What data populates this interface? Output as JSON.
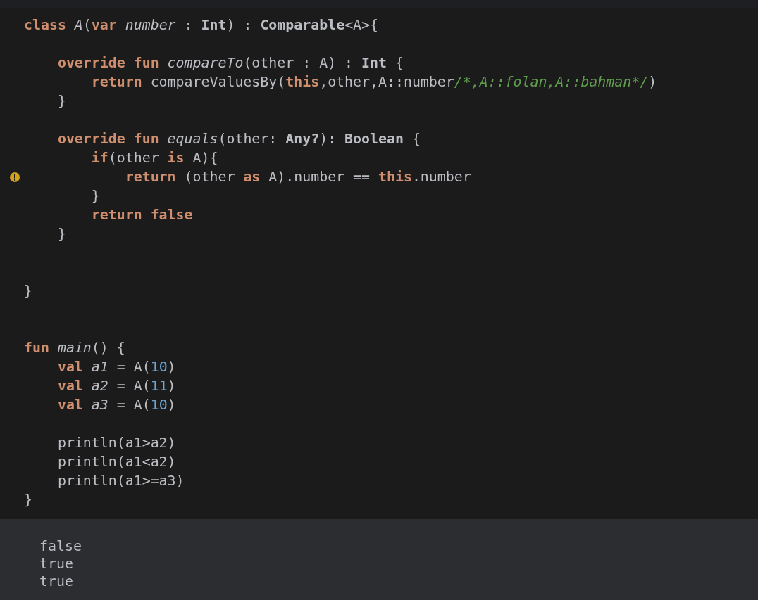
{
  "editor": {
    "lines": [
      {
        "kind": "code",
        "warning": false,
        "tokens": [
          {
            "t": "class ",
            "kind": "kw"
          },
          {
            "t": "A",
            "kind": "italic"
          },
          {
            "t": "(",
            "kind": "txt"
          },
          {
            "t": "var ",
            "kind": "kw"
          },
          {
            "t": "number",
            "kind": "italic"
          },
          {
            "t": " : ",
            "kind": "txt"
          },
          {
            "t": "Int",
            "kind": "type"
          },
          {
            "t": ") : ",
            "kind": "txt"
          },
          {
            "t": "Comparable",
            "kind": "type"
          },
          {
            "t": "<A>{",
            "kind": "txt"
          }
        ]
      },
      {
        "kind": "blank",
        "warning": false
      },
      {
        "kind": "code",
        "warning": false,
        "tokens": [
          {
            "t": "    override fun ",
            "kind": "kw"
          },
          {
            "t": "compareTo",
            "kind": "italic"
          },
          {
            "t": "(other : A) : ",
            "kind": "txt"
          },
          {
            "t": "Int",
            "kind": "type"
          },
          {
            "t": " {",
            "kind": "txt"
          }
        ]
      },
      {
        "kind": "code",
        "warning": false,
        "tokens": [
          {
            "t": "        return",
            "kind": "kw"
          },
          {
            "t": " compareValuesBy(",
            "kind": "txt"
          },
          {
            "t": "this",
            "kind": "kw"
          },
          {
            "t": ",other,A::number",
            "kind": "txt"
          },
          {
            "t": "/*,A::folan,A::bahman*/",
            "kind": "comment"
          },
          {
            "t": ")",
            "kind": "txt"
          }
        ]
      },
      {
        "kind": "code",
        "warning": false,
        "tokens": [
          {
            "t": "    }",
            "kind": "txt"
          }
        ]
      },
      {
        "kind": "blank",
        "warning": false
      },
      {
        "kind": "code",
        "warning": false,
        "tokens": [
          {
            "t": "    override fun ",
            "kind": "kw"
          },
          {
            "t": "equals",
            "kind": "italic"
          },
          {
            "t": "(other: ",
            "kind": "txt"
          },
          {
            "t": "Any?",
            "kind": "type"
          },
          {
            "t": "): ",
            "kind": "txt"
          },
          {
            "t": "Boolean",
            "kind": "type"
          },
          {
            "t": " {",
            "kind": "txt"
          }
        ]
      },
      {
        "kind": "code",
        "warning": false,
        "tokens": [
          {
            "t": "        if",
            "kind": "kw"
          },
          {
            "t": "(other ",
            "kind": "txt"
          },
          {
            "t": "is",
            "kind": "kw"
          },
          {
            "t": " A){",
            "kind": "txt"
          }
        ]
      },
      {
        "kind": "code",
        "warning": true,
        "tokens": [
          {
            "t": "            return",
            "kind": "kw"
          },
          {
            "t": " (other ",
            "kind": "txt"
          },
          {
            "t": "as",
            "kind": "kw"
          },
          {
            "t": " A).number == ",
            "kind": "txt"
          },
          {
            "t": "this",
            "kind": "kw"
          },
          {
            "t": ".number",
            "kind": "txt"
          }
        ]
      },
      {
        "kind": "code",
        "warning": false,
        "tokens": [
          {
            "t": "        }",
            "kind": "txt"
          }
        ]
      },
      {
        "kind": "code",
        "warning": false,
        "tokens": [
          {
            "t": "        return false",
            "kind": "kw"
          }
        ]
      },
      {
        "kind": "code",
        "warning": false,
        "tokens": [
          {
            "t": "    }",
            "kind": "txt"
          }
        ]
      },
      {
        "kind": "blank",
        "warning": false
      },
      {
        "kind": "blank",
        "warning": false
      },
      {
        "kind": "code",
        "warning": false,
        "tokens": [
          {
            "t": "}",
            "kind": "txt"
          }
        ]
      },
      {
        "kind": "blank",
        "warning": false
      },
      {
        "kind": "blank",
        "warning": false
      },
      {
        "kind": "code",
        "warning": false,
        "tokens": [
          {
            "t": "fun ",
            "kind": "kw"
          },
          {
            "t": "main",
            "kind": "italic"
          },
          {
            "t": "() {",
            "kind": "txt"
          }
        ]
      },
      {
        "kind": "code",
        "warning": false,
        "tokens": [
          {
            "t": "    val ",
            "kind": "kw"
          },
          {
            "t": "a1",
            "kind": "italic"
          },
          {
            "t": " = A(",
            "kind": "txt"
          },
          {
            "t": "10",
            "kind": "num"
          },
          {
            "t": ")",
            "kind": "txt"
          }
        ]
      },
      {
        "kind": "code",
        "warning": false,
        "tokens": [
          {
            "t": "    val ",
            "kind": "kw"
          },
          {
            "t": "a2",
            "kind": "italic"
          },
          {
            "t": " = A(",
            "kind": "txt"
          },
          {
            "t": "11",
            "kind": "num"
          },
          {
            "t": ")",
            "kind": "txt"
          }
        ]
      },
      {
        "kind": "code",
        "warning": false,
        "tokens": [
          {
            "t": "    val ",
            "kind": "kw"
          },
          {
            "t": "a3",
            "kind": "italic"
          },
          {
            "t": " = A(",
            "kind": "txt"
          },
          {
            "t": "10",
            "kind": "num"
          },
          {
            "t": ")",
            "kind": "txt"
          }
        ]
      },
      {
        "kind": "blank",
        "warning": false
      },
      {
        "kind": "code",
        "warning": false,
        "tokens": [
          {
            "t": "    println(a1>a2)",
            "kind": "txt"
          }
        ]
      },
      {
        "kind": "code",
        "warning": false,
        "tokens": [
          {
            "t": "    println(a1<a2)",
            "kind": "txt"
          }
        ]
      },
      {
        "kind": "code",
        "warning": false,
        "tokens": [
          {
            "t": "    println(a1>=a3)",
            "kind": "txt"
          }
        ]
      },
      {
        "kind": "code",
        "warning": false,
        "tokens": [
          {
            "t": "}",
            "kind": "txt"
          }
        ]
      }
    ]
  },
  "output": {
    "lines": [
      "false",
      "true",
      "true"
    ]
  }
}
